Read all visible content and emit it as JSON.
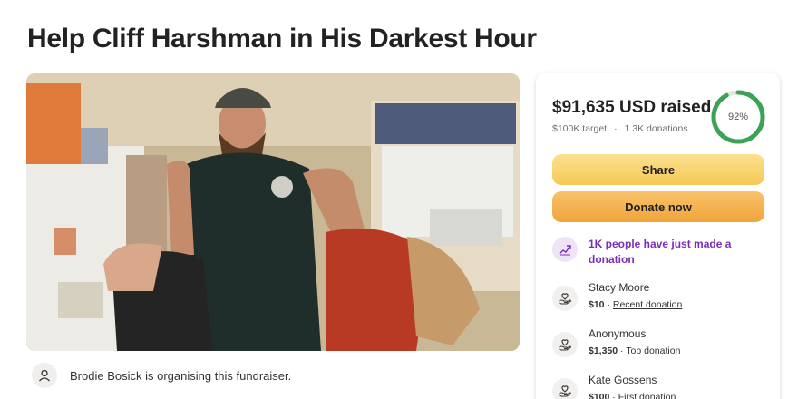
{
  "page": {
    "title": "Help Cliff Harshman in His Darkest Hour"
  },
  "organiser": {
    "text": "Brodie Bosick is organising this fundraiser."
  },
  "stats": {
    "raised_amount": "$91,635",
    "raised_suffix": " USD raised",
    "target": "$100K target",
    "separator": "·",
    "donations": "1.3K donations",
    "progress_percent": 92,
    "progress_label": "92%"
  },
  "buttons": {
    "share": "Share",
    "donate": "Donate now"
  },
  "activity": {
    "trend_text": "1K people have just made a donation"
  },
  "donations_list": [
    {
      "name": "Stacy Moore",
      "amount": "$10",
      "sep": " · ",
      "tag": "Recent donation"
    },
    {
      "name": "Anonymous",
      "amount": "$1,350",
      "sep": " · ",
      "tag": "Top donation"
    },
    {
      "name": "Kate Gossens",
      "amount": "$100",
      "sep": " · ",
      "tag": "First donation"
    }
  ],
  "colors": {
    "progress_ring": "#3aa356",
    "ring_track": "#e3e3e3",
    "trend_accent": "#7a2eb8",
    "share_button": "#f6c956",
    "donate_button": "#f1a43a"
  },
  "icons": {
    "organiser_avatar": "person-icon",
    "trend": "trending-up-icon",
    "donor": "heart-hand-icon"
  }
}
